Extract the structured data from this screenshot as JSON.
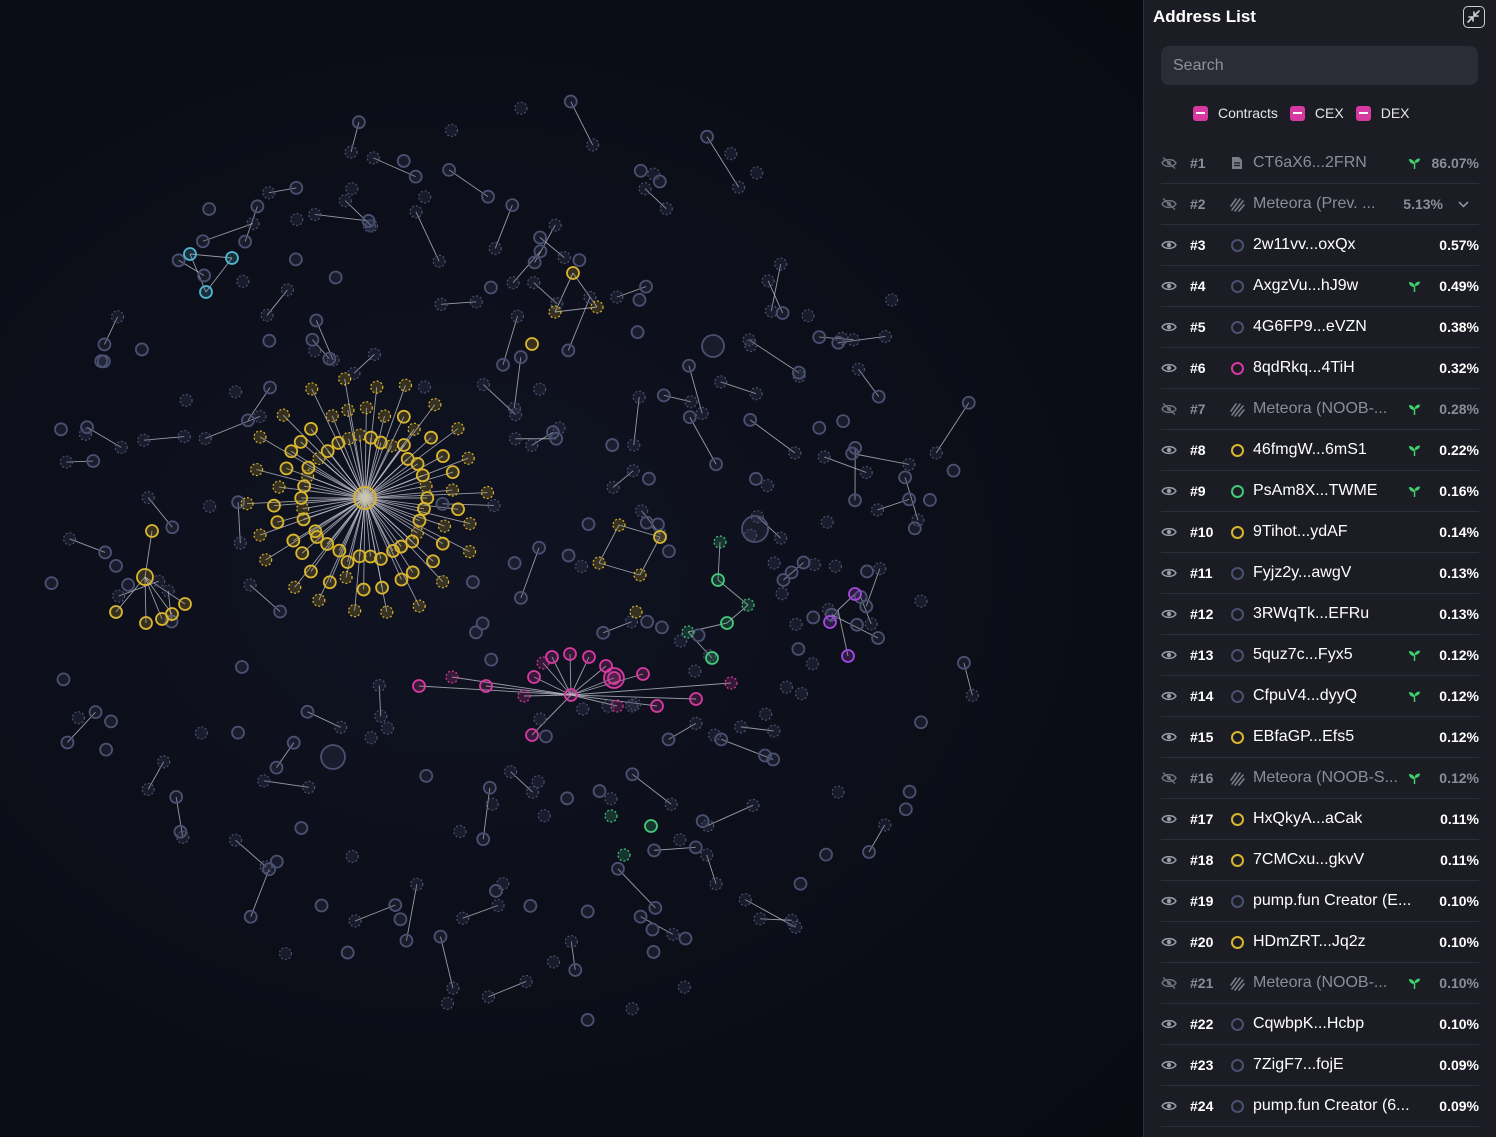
{
  "panel": {
    "title": "Address List",
    "search_placeholder": "Search",
    "filters": [
      {
        "label": "Contracts",
        "color": "#d63aa0"
      },
      {
        "label": "CEX",
        "color": "#d63aa0"
      },
      {
        "label": "DEX",
        "color": "#d63aa0"
      }
    ]
  },
  "colors": {
    "default_node": "#4a5070",
    "yellow_node": "#d9b62e",
    "magenta_node": "#d63aa0",
    "green_node": "#43c97b",
    "cyan_node": "#4fb6cf",
    "purple_node": "#a448e0",
    "sprout": "#3fcf6d"
  },
  "rows": [
    {
      "rank": "#1",
      "name": "CT6aX6...2FRN",
      "percent": "86.07%",
      "visible": false,
      "type_icon": "document-icon",
      "sprout": true,
      "dim": true
    },
    {
      "rank": "#2",
      "name": "Meteora (Prev. ...",
      "percent": "5.13%",
      "visible": false,
      "type_icon": "meteora-icon",
      "sprout": false,
      "dim": true,
      "expandable": true
    },
    {
      "rank": "#3",
      "name": "2w11vv...oxQx",
      "percent": "0.57%",
      "visible": true,
      "type_icon": "circle-icon",
      "ring": "#4a5070",
      "sprout": false
    },
    {
      "rank": "#4",
      "name": "AxgzVu...hJ9w",
      "percent": "0.49%",
      "visible": true,
      "type_icon": "circle-icon",
      "ring": "#4a5070",
      "sprout": true
    },
    {
      "rank": "#5",
      "name": "4G6FP9...eVZN",
      "percent": "0.38%",
      "visible": true,
      "type_icon": "circle-icon",
      "ring": "#4a5070",
      "sprout": false
    },
    {
      "rank": "#6",
      "name": "8qdRkq...4TiH",
      "percent": "0.32%",
      "visible": true,
      "type_icon": "circle-icon",
      "ring": "#d63aa0",
      "sprout": false
    },
    {
      "rank": "#7",
      "name": "Meteora (NOOB-...",
      "percent": "0.28%",
      "visible": false,
      "type_icon": "meteora-icon",
      "sprout": true,
      "dim": true
    },
    {
      "rank": "#8",
      "name": "46fmgW...6mS1",
      "percent": "0.22%",
      "visible": true,
      "type_icon": "circle-icon",
      "ring": "#d9b62e",
      "sprout": true
    },
    {
      "rank": "#9",
      "name": "PsAm8X...TWME",
      "percent": "0.16%",
      "visible": true,
      "type_icon": "circle-icon",
      "ring": "#43c97b",
      "sprout": true
    },
    {
      "rank": "#10",
      "name": "9Tihot...ydAF",
      "percent": "0.14%",
      "visible": true,
      "type_icon": "circle-icon",
      "ring": "#d9b62e",
      "sprout": false
    },
    {
      "rank": "#11",
      "name": "Fyjz2y...awgV",
      "percent": "0.13%",
      "visible": true,
      "type_icon": "circle-icon",
      "ring": "#4a5070",
      "sprout": false
    },
    {
      "rank": "#12",
      "name": "3RWqTk...EFRu",
      "percent": "0.13%",
      "visible": true,
      "type_icon": "circle-icon",
      "ring": "#4a5070",
      "sprout": false
    },
    {
      "rank": "#13",
      "name": "5quz7c...Fyx5",
      "percent": "0.12%",
      "visible": true,
      "type_icon": "circle-icon",
      "ring": "#4a5070",
      "sprout": true
    },
    {
      "rank": "#14",
      "name": "CfpuV4...dyyQ",
      "percent": "0.12%",
      "visible": true,
      "type_icon": "circle-icon",
      "ring": "#4a5070",
      "sprout": true
    },
    {
      "rank": "#15",
      "name": "EBfaGP...Efs5",
      "percent": "0.12%",
      "visible": true,
      "type_icon": "circle-icon",
      "ring": "#d9b62e",
      "sprout": false
    },
    {
      "rank": "#16",
      "name": "Meteora (NOOB-S...",
      "percent": "0.12%",
      "visible": false,
      "type_icon": "meteora-icon",
      "sprout": true,
      "dim": true
    },
    {
      "rank": "#17",
      "name": "HxQkyA...aCak",
      "percent": "0.11%",
      "visible": true,
      "type_icon": "circle-icon",
      "ring": "#d9b62e",
      "sprout": false
    },
    {
      "rank": "#18",
      "name": "7CMCxu...gkvV",
      "percent": "0.11%",
      "visible": true,
      "type_icon": "circle-icon",
      "ring": "#d9b62e",
      "sprout": false
    },
    {
      "rank": "#19",
      "name": "pump.fun Creator (E...",
      "percent": "0.10%",
      "visible": true,
      "type_icon": "circle-icon",
      "ring": "#4a5070",
      "sprout": false
    },
    {
      "rank": "#20",
      "name": "HDmZRT...Jq2z",
      "percent": "0.10%",
      "visible": true,
      "type_icon": "circle-icon",
      "ring": "#d9b62e",
      "sprout": false
    },
    {
      "rank": "#21",
      "name": "Meteora (NOOB-...",
      "percent": "0.10%",
      "visible": false,
      "type_icon": "meteora-icon",
      "sprout": true,
      "dim": true
    },
    {
      "rank": "#22",
      "name": "CqwbpK...Hcbp",
      "percent": "0.10%",
      "visible": true,
      "type_icon": "circle-icon",
      "ring": "#4a5070",
      "sprout": false
    },
    {
      "rank": "#23",
      "name": "7ZigF7...fojE",
      "percent": "0.09%",
      "visible": true,
      "type_icon": "circle-icon",
      "ring": "#4a5070",
      "sprout": false
    },
    {
      "rank": "#24",
      "name": "pump.fun Creator (6...",
      "percent": "0.09%",
      "visible": true,
      "type_icon": "circle-icon",
      "ring": "#4a5070",
      "sprout": false
    }
  ]
}
